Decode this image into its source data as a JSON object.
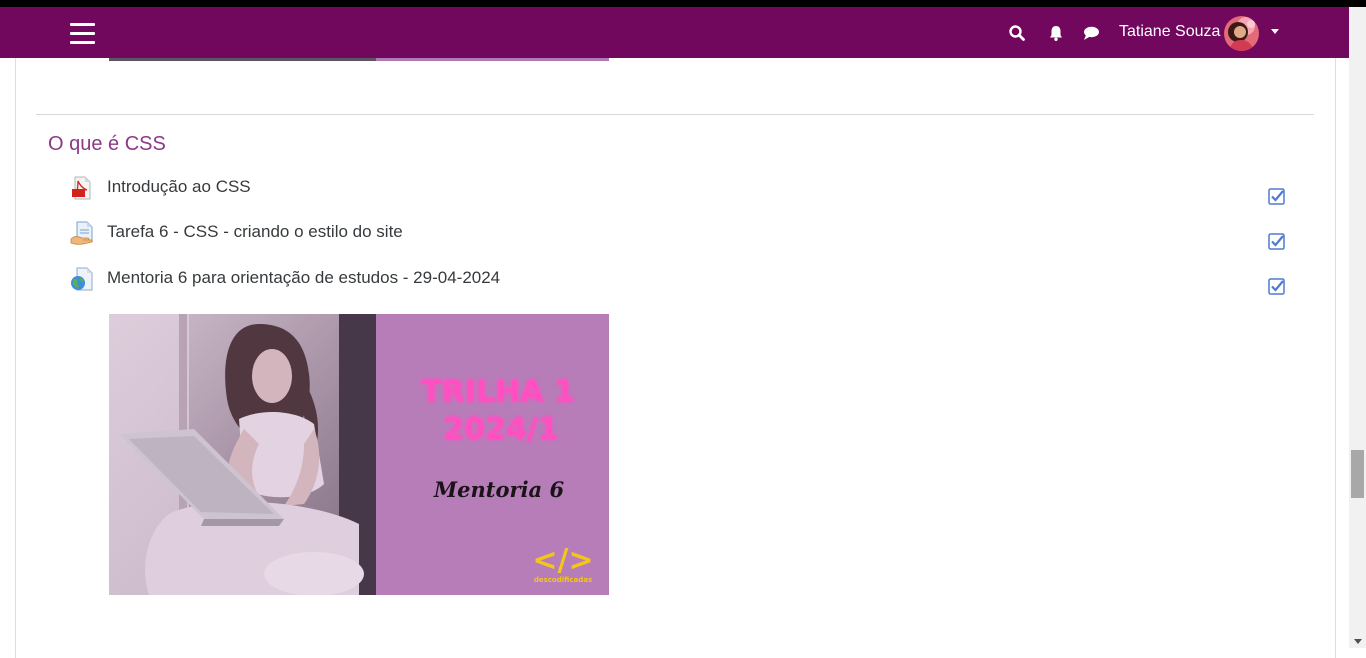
{
  "header": {
    "user_name": "Tatiane Souza",
    "menu_icon": "hamburger-menu-icon",
    "search_icon": "search-icon",
    "notifications_icon": "bell-icon",
    "messages_icon": "chat-bubble-icon",
    "brand_color": "#72075e"
  },
  "section": {
    "title": "O que é CSS",
    "title_color": "#8c3a87",
    "activities": [
      {
        "label": "Introdução ao CSS",
        "icon": "pdf-file-icon",
        "completed": true
      },
      {
        "label": "Tarefa 6 - CSS - criando o estilo do site",
        "icon": "assignment-icon",
        "completed": true
      },
      {
        "label": "Mentoria 6 para orientação de estudos - 29-04-2024",
        "icon": "url-globe-icon",
        "completed": true
      }
    ]
  },
  "banner": {
    "line1": "TRILHA 1",
    "line2": "2024/1",
    "subtitle": "Mentoria 6",
    "logo_text": "descodificadas",
    "logo_symbol": "</>"
  }
}
